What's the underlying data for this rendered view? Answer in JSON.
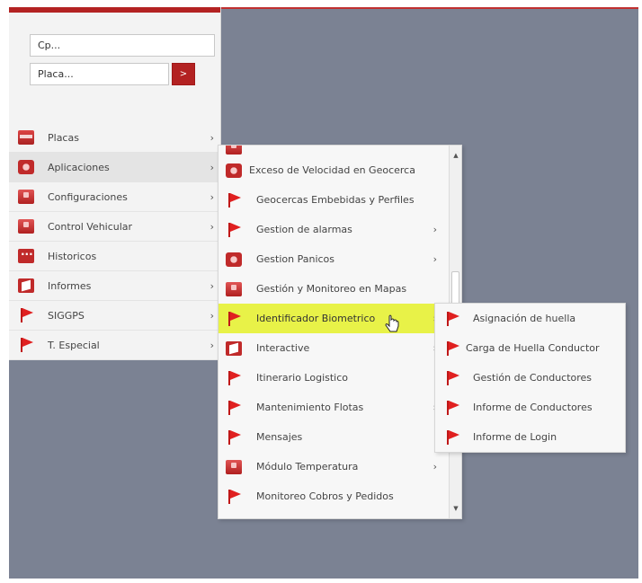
{
  "search": {
    "cp_placeholder": "Cp...",
    "placa_placeholder": "Placa...",
    "go_label": ">"
  },
  "menu": {
    "items": [
      {
        "label": "Placas",
        "icon": "plate-icon",
        "has_submenu": true
      },
      {
        "label": "Aplicaciones",
        "icon": "app-icon",
        "has_submenu": true
      },
      {
        "label": "Configuraciones",
        "icon": "box-icon",
        "has_submenu": true
      },
      {
        "label": "Control Vehicular",
        "icon": "box-icon",
        "has_submenu": true
      },
      {
        "label": "Historicos",
        "icon": "history-icon",
        "has_submenu": false
      },
      {
        "label": "Informes",
        "icon": "document-icon",
        "has_submenu": true
      },
      {
        "label": "SIGGPS",
        "icon": "flag-icon",
        "has_submenu": true
      },
      {
        "label": "T. Especial",
        "icon": "flag-icon",
        "has_submenu": true
      }
    ],
    "arrow": "›"
  },
  "submenu": {
    "items": [
      {
        "label": "Exceso de Velocidad en Geocerca",
        "icon": "app-icon",
        "has_submenu": false
      },
      {
        "label": "Geocercas Embebidas y Perfiles",
        "icon": "flag-icon",
        "has_submenu": false
      },
      {
        "label": "Gestion de alarmas",
        "icon": "flag-icon",
        "has_submenu": true
      },
      {
        "label": "Gestion Panicos",
        "icon": "app-icon",
        "has_submenu": true
      },
      {
        "label": "Gestión y Monitoreo en Mapas",
        "icon": "box-icon",
        "has_submenu": false
      },
      {
        "label": "Identificador Biometrico",
        "icon": "flag-icon",
        "has_submenu": true,
        "highlighted": true
      },
      {
        "label": "Interactive",
        "icon": "document-icon",
        "has_submenu": true
      },
      {
        "label": "Itinerario Logistico",
        "icon": "flag-icon",
        "has_submenu": false
      },
      {
        "label": "Mantenimiento Flotas",
        "icon": "flag-icon",
        "has_submenu": true
      },
      {
        "label": "Mensajes",
        "icon": "flag-icon",
        "has_submenu": false
      },
      {
        "label": "Módulo Temperatura",
        "icon": "box-icon",
        "has_submenu": true
      },
      {
        "label": "Monitoreo Cobros y Pedidos",
        "icon": "flag-icon",
        "has_submenu": false
      }
    ]
  },
  "subsubmenu": {
    "items": [
      {
        "label": "Asignación de huella"
      },
      {
        "label": "Carga de Huella Conductor"
      },
      {
        "label": "Gestión de Conductores"
      },
      {
        "label": "Informe de Conductores"
      },
      {
        "label": "Informe de Login"
      }
    ]
  },
  "colors": {
    "brand_red": "#b32222",
    "highlight": "#e8f248",
    "desktop_bg": "#7b8293"
  }
}
